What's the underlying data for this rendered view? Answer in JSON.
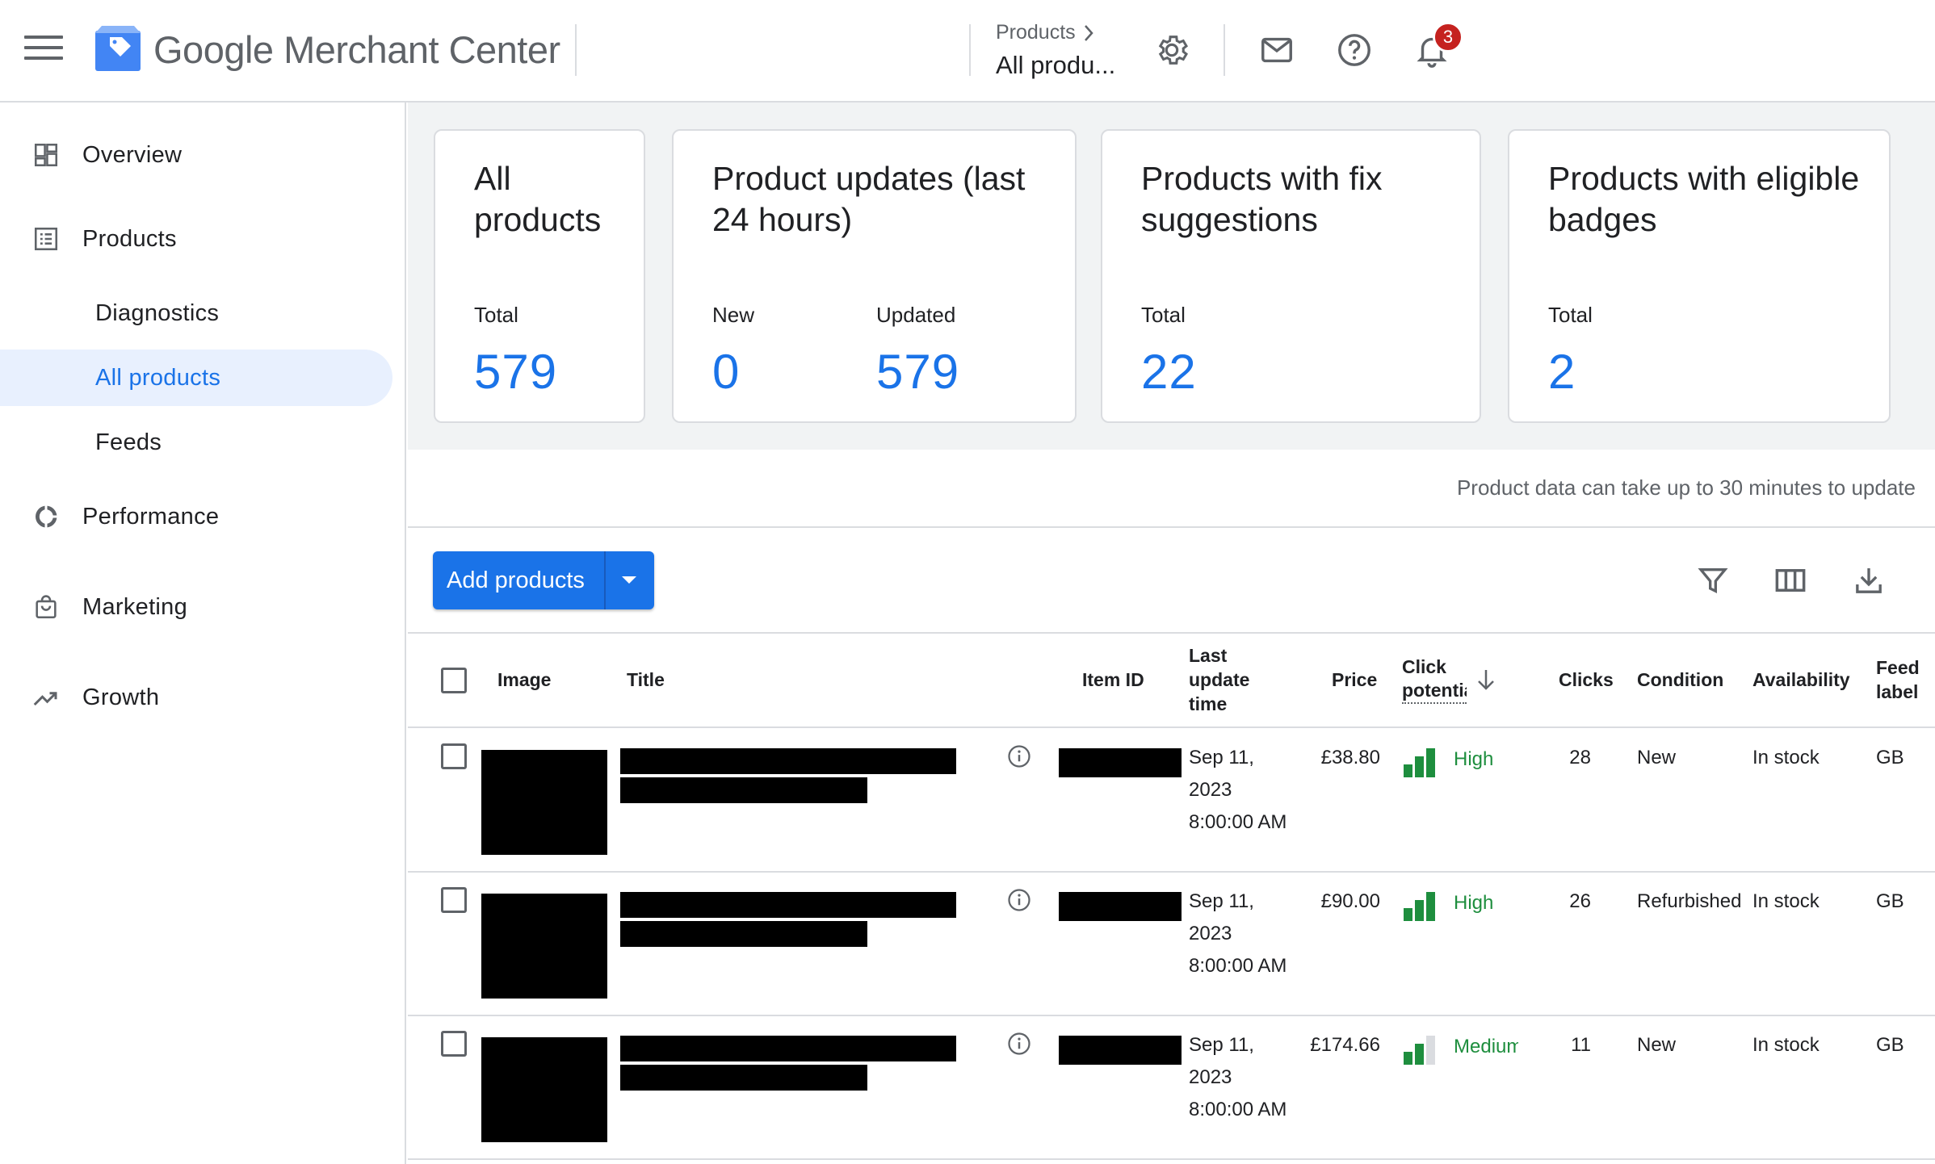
{
  "header": {
    "app_name": "Google Merchant Center",
    "breadcrumb_parent": "Products",
    "breadcrumb_current": "All produ...",
    "notification_count": "3",
    "icons": [
      "menu-icon",
      "merchant-center-logo",
      "chevron-right-icon",
      "gear-icon",
      "mail-icon",
      "help-icon",
      "bell-icon"
    ]
  },
  "sidebar": {
    "items": [
      {
        "label": "Overview",
        "icon": "dashboard-icon"
      },
      {
        "label": "Products",
        "icon": "list-icon"
      },
      {
        "label": "Diagnostics"
      },
      {
        "label": "All products",
        "active": true
      },
      {
        "label": "Feeds"
      },
      {
        "label": "Performance",
        "icon": "donut-chart-icon"
      },
      {
        "label": "Marketing",
        "icon": "shopping-bag-icon"
      },
      {
        "label": "Growth",
        "icon": "trending-up-icon"
      }
    ]
  },
  "cards": [
    {
      "title": "All products",
      "metrics": [
        {
          "label": "Total",
          "value": "579"
        }
      ]
    },
    {
      "title": "Product updates (last 24 hours)",
      "metrics": [
        {
          "label": "New",
          "value": "0"
        },
        {
          "label": "Updated",
          "value": "579"
        }
      ]
    },
    {
      "title": "Products with fix suggestions",
      "metrics": [
        {
          "label": "Total",
          "value": "22"
        }
      ]
    },
    {
      "title": "Products with eligible badges",
      "metrics": [
        {
          "label": "Total",
          "value": "2"
        }
      ]
    }
  ],
  "notice": "Product data can take up to 30 minutes to update",
  "toolbar": {
    "add_products_label": "Add products",
    "icons": [
      "filter-icon",
      "columns-icon",
      "download-icon"
    ]
  },
  "table": {
    "headers": {
      "image": "Image",
      "title": "Title",
      "item_id": "Item ID",
      "last_update": "Last update time",
      "price": "Price",
      "click_potential": "Click potential",
      "clicks": "Clicks",
      "condition": "Condition",
      "availability": "Availability",
      "feed_label": "Feed label"
    },
    "rows": [
      {
        "date": "Sep 11,",
        "year": "2023",
        "time": "8:00:00 AM",
        "price": "£38.80",
        "click_potential": "High",
        "click_level": 3,
        "clicks": "28",
        "condition": "New",
        "availability": "In stock",
        "feed_label": "GB"
      },
      {
        "date": "Sep 11,",
        "year": "2023",
        "time": "8:00:00 AM",
        "price": "£90.00",
        "click_potential": "High",
        "click_level": 3,
        "clicks": "26",
        "condition": "Refurbished",
        "availability": "In stock",
        "feed_label": "GB"
      },
      {
        "date": "Sep 11,",
        "year": "2023",
        "time": "8:00:00 AM",
        "price": "£174.66",
        "click_potential": "Medium",
        "click_level": 2,
        "clicks": "11",
        "condition": "New",
        "availability": "In stock",
        "feed_label": "GB"
      }
    ]
  },
  "colors": {
    "accent": "#1a73e8",
    "positive": "#1e8e3e",
    "badge": "#c5221f"
  }
}
